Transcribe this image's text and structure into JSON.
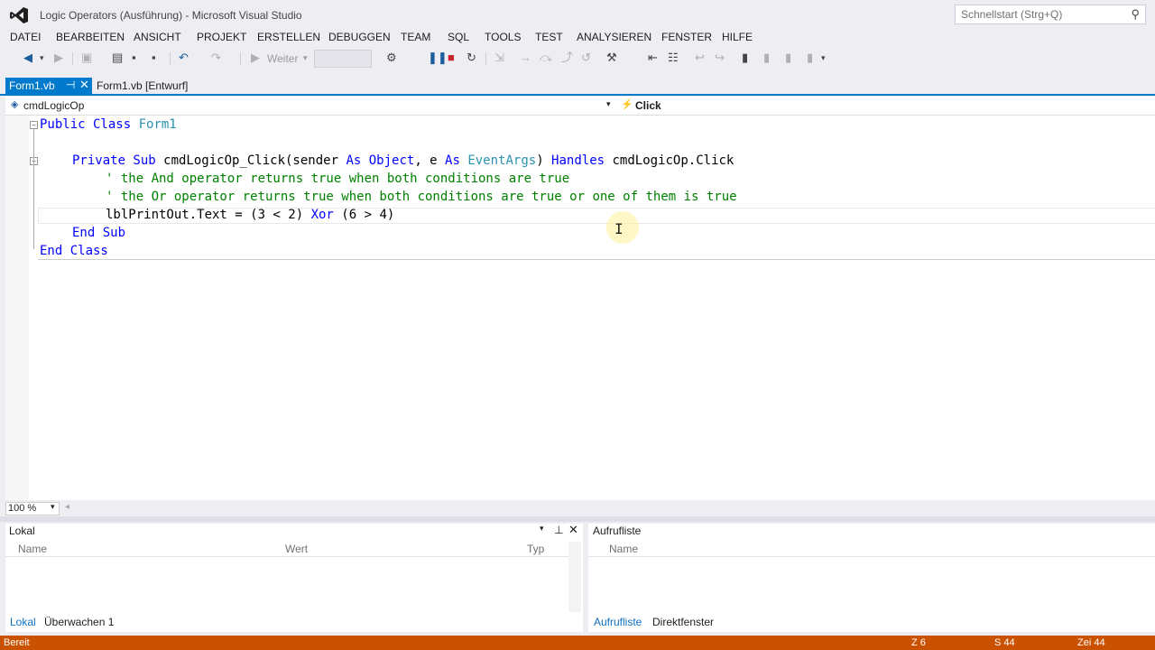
{
  "window": {
    "title": "Logic Operators (Ausführung) - Microsoft Visual Studio"
  },
  "quick_launch": {
    "placeholder": "Schnellstart (Strg+Q)"
  },
  "menu": [
    "DATEI",
    "BEARBEITEN",
    "ANSICHT",
    "PROJEKT",
    "ERSTELLEN",
    "DEBUGGEN",
    "TEAM",
    "SQL",
    "TOOLS",
    "TEST",
    "ANALYSIEREN",
    "FENSTER",
    "HILFE"
  ],
  "toolbar": {
    "continue_label": "Weiter"
  },
  "tabs": [
    {
      "label": "Form1.vb",
      "active": true
    },
    {
      "label": "Form1.vb [Entwurf]",
      "active": false
    }
  ],
  "nav": {
    "object": "cmdLogicOp",
    "event": "Click"
  },
  "code": {
    "line1a": "Public Class",
    "line1b": " Form1",
    "sub_kw": "Private Sub",
    "sub_name": " cmdLogicOp_Click(sender ",
    "as1": "As",
    "obj": " Object",
    "e": ", e ",
    "as2": "As",
    "evargs": " EventArgs",
    "handles_pre": ") ",
    "handles": "Handles",
    "handles_post": " cmdLogicOp.Click",
    "comment1": "' the And operator returns true when both conditions are true",
    "comment2": "' the Or operator returns true when both conditions are true or one of them is true",
    "stmt_a": "lblPrintOut.Text = (3 < 2) ",
    "xor": "Xor",
    "stmt_b": " (6 > 4)",
    "end_sub": "End Sub",
    "end_class": "End Class"
  },
  "zoom": "100 %",
  "panels": {
    "locals": {
      "title": "Lokal",
      "columns": [
        "Name",
        "Wert",
        "Typ"
      ]
    },
    "callstack": {
      "title": "Aufrufliste",
      "columns": [
        "Name"
      ]
    }
  },
  "bottom_tabs_left": [
    "Lokal",
    "Überwachen 1"
  ],
  "bottom_tabs_right": [
    "Aufrufliste",
    "Direktfenster"
  ],
  "status": {
    "text": "Bereit",
    "line": "Z 6",
    "col": "S 44",
    "char": "Zei 44"
  },
  "colors": {
    "accent": "#007acc",
    "status_debug": "#ca5100"
  }
}
